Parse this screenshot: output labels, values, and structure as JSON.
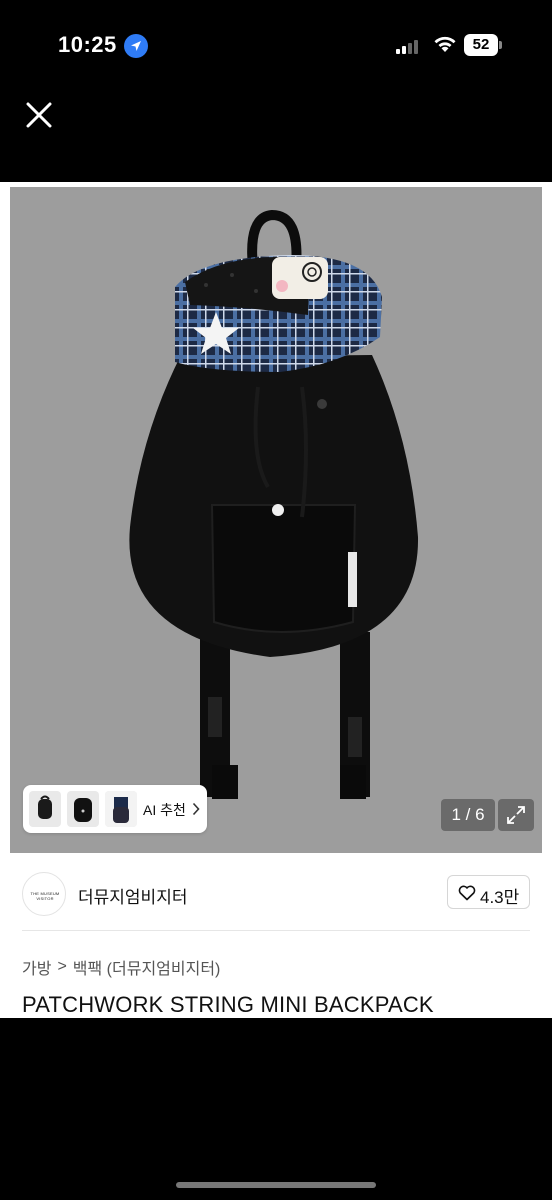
{
  "status_bar": {
    "time": "10:25",
    "battery": "52",
    "location_icon": "location-arrow-icon",
    "signal_icon": "cellular-signal-icon",
    "wifi_icon": "wifi-icon"
  },
  "top_bar": {
    "close_icon": "close-icon"
  },
  "gallery": {
    "counter": "1 / 6",
    "current_index": 1,
    "total": 6,
    "expand_icon": "expand-icon",
    "background_color": "#9d9d9d"
  },
  "ai_recommend": {
    "label": "AI 추천",
    "chevron_icon": "chevron-right-icon"
  },
  "shop": {
    "name": "더뮤지엄비지터",
    "avatar_text": "THE MUSEUM VISITOR",
    "likes": "4.3만",
    "heart_icon": "heart-outline-icon"
  },
  "breadcrumb": {
    "category": "가방",
    "separator": ">",
    "subcategory": "백팩 (더뮤지엄비지터)"
  },
  "product": {
    "title": "PATCHWORK STRING MINI BACKPACK"
  },
  "colors": {
    "location_blue": "#2f7cf6",
    "sheet_bg": "#ffffff",
    "screen_bg": "#000000"
  }
}
